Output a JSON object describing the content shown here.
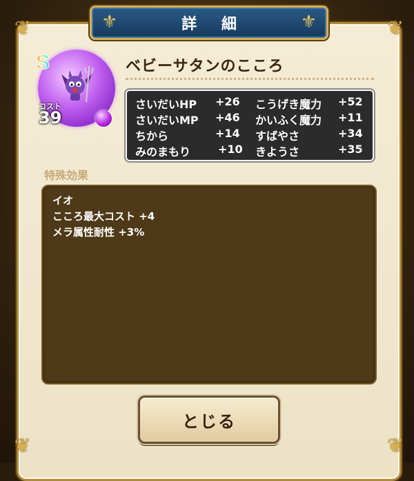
{
  "dialog": {
    "title": "詳 細"
  },
  "monster": {
    "rank": "S",
    "cost_label": "コスト",
    "cost": "39",
    "name": "ベビーサタンのこころ"
  },
  "stats": [
    {
      "label": "さいだいHP",
      "value": "+26"
    },
    {
      "label": "こうげき魔力",
      "value": "+52"
    },
    {
      "label": "さいだいMP",
      "value": "+46"
    },
    {
      "label": "かいふく魔力",
      "value": "+11"
    },
    {
      "label": "ちから",
      "value": "+14"
    },
    {
      "label": "すばやさ",
      "value": "+34"
    },
    {
      "label": "みのまもり",
      "value": "+10"
    },
    {
      "label": "きようさ",
      "value": "+35"
    }
  ],
  "special": {
    "heading": "特殊効果",
    "effects": [
      "イオ",
      "こころ最大コスト +4",
      "メラ属性耐性 +3%"
    ]
  },
  "close_button": {
    "label": "とじる"
  },
  "colors": {
    "banner": "#163a5c",
    "gold": "#d8b050",
    "stat_panel": "#2b2b2b",
    "effect_panel": "#4e3a18"
  }
}
